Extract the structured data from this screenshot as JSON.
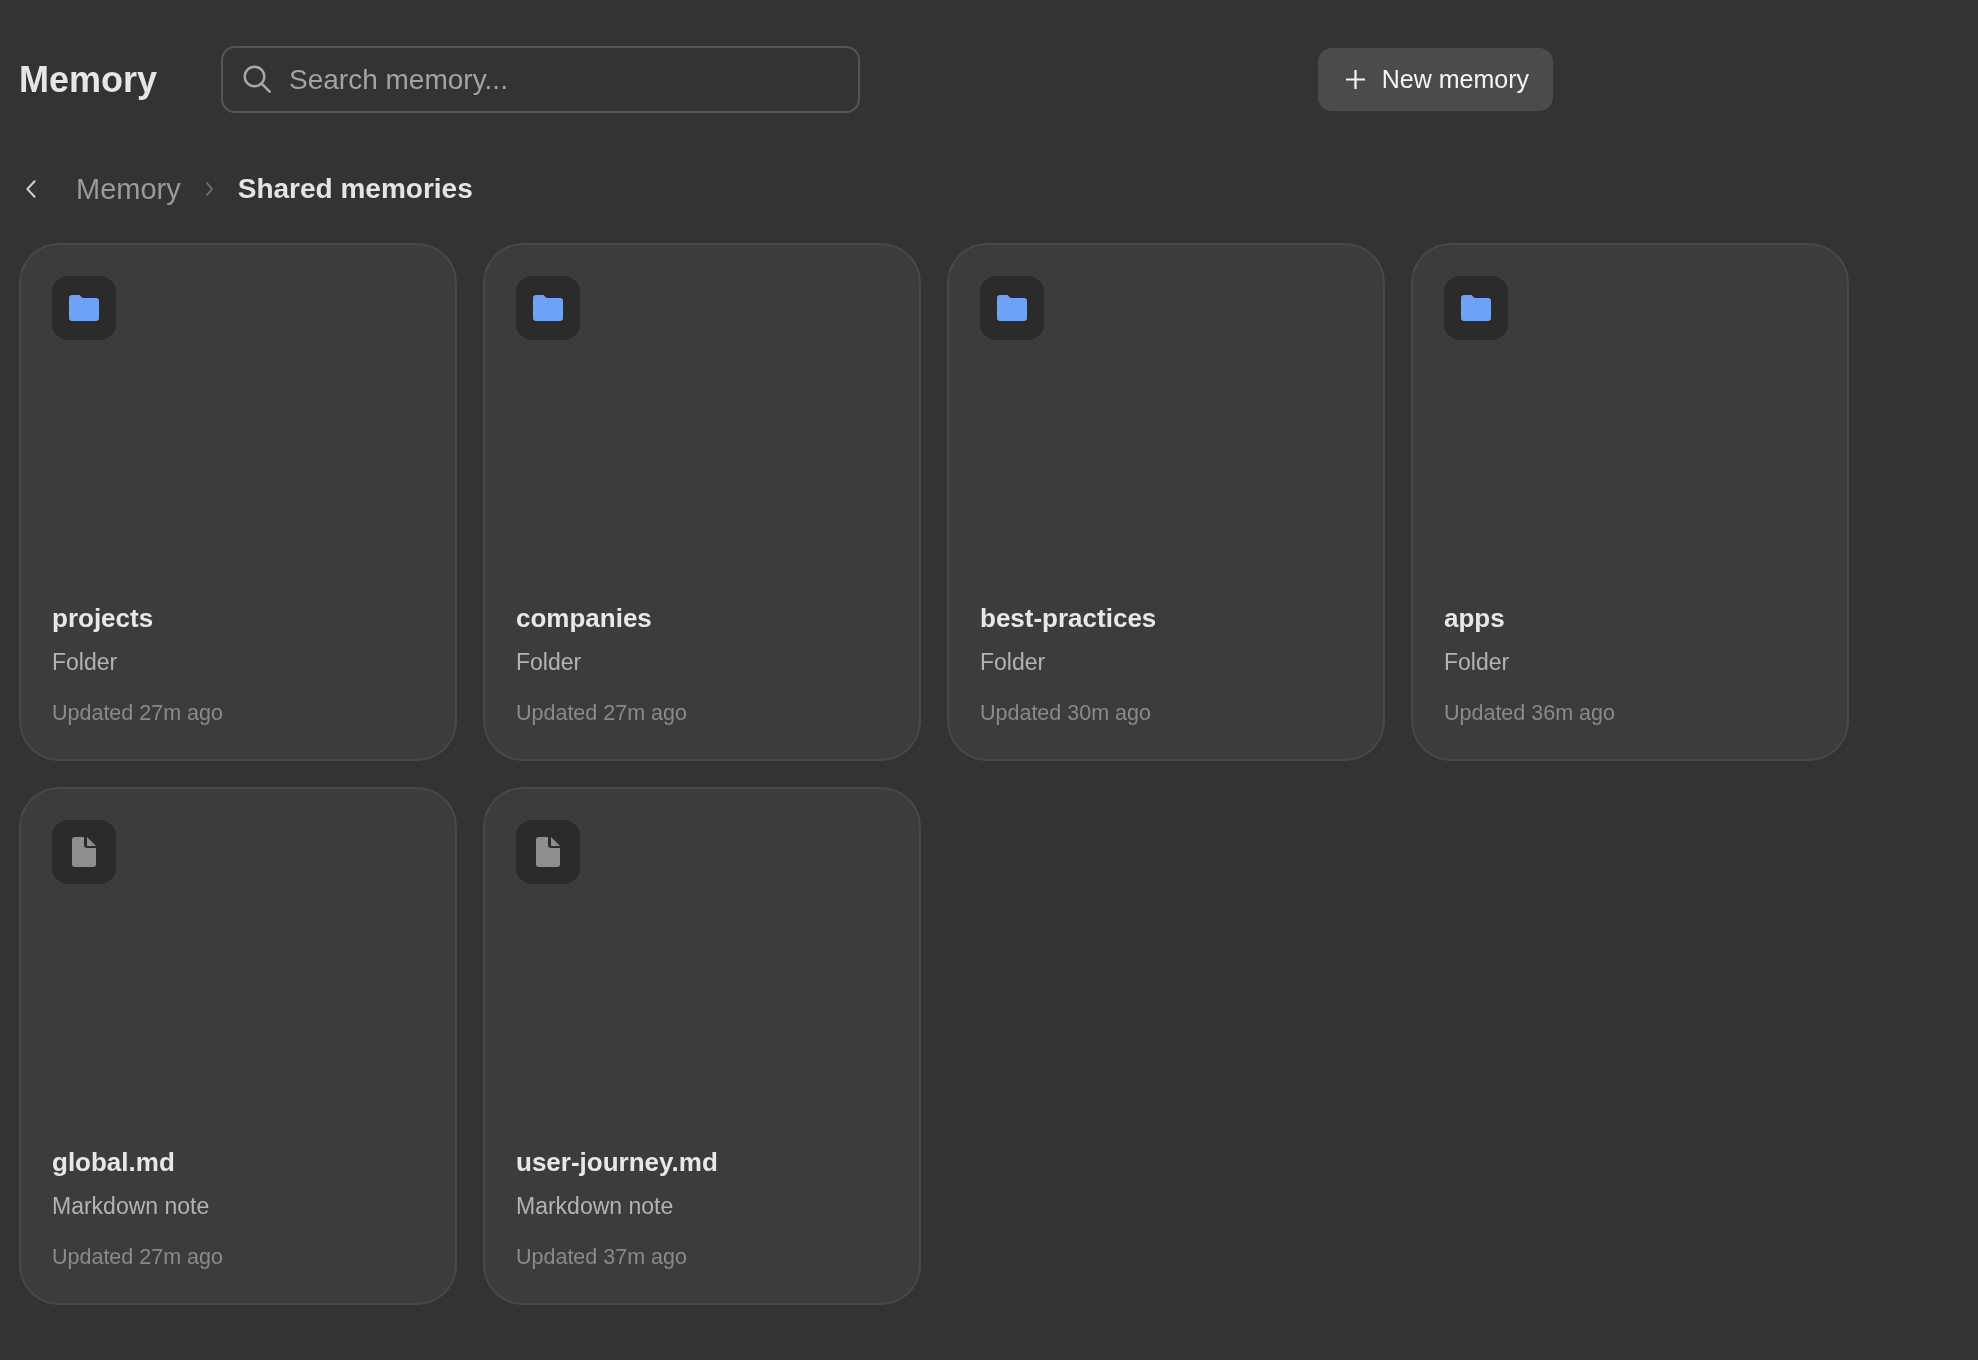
{
  "header": {
    "title": "Memory",
    "search": {
      "placeholder": "Search memory..."
    },
    "new_button": {
      "label": "New memory"
    }
  },
  "breadcrumb": [
    {
      "label": "Memory",
      "current": false
    },
    {
      "label": "Shared memories",
      "current": true
    }
  ],
  "items": [
    {
      "kind": "folder",
      "name": "projects",
      "type_label": "Folder",
      "updated": "Updated 27m ago"
    },
    {
      "kind": "folder",
      "name": "companies",
      "type_label": "Folder",
      "updated": "Updated 27m ago"
    },
    {
      "kind": "folder",
      "name": "best-practices",
      "type_label": "Folder",
      "updated": "Updated 30m ago"
    },
    {
      "kind": "folder",
      "name": "apps",
      "type_label": "Folder",
      "updated": "Updated 36m ago"
    },
    {
      "kind": "file",
      "name": "global.md",
      "type_label": "Markdown note",
      "updated": "Updated 27m ago"
    },
    {
      "kind": "file",
      "name": "user-journey.md",
      "type_label": "Markdown note",
      "updated": "Updated 37m ago"
    }
  ]
}
